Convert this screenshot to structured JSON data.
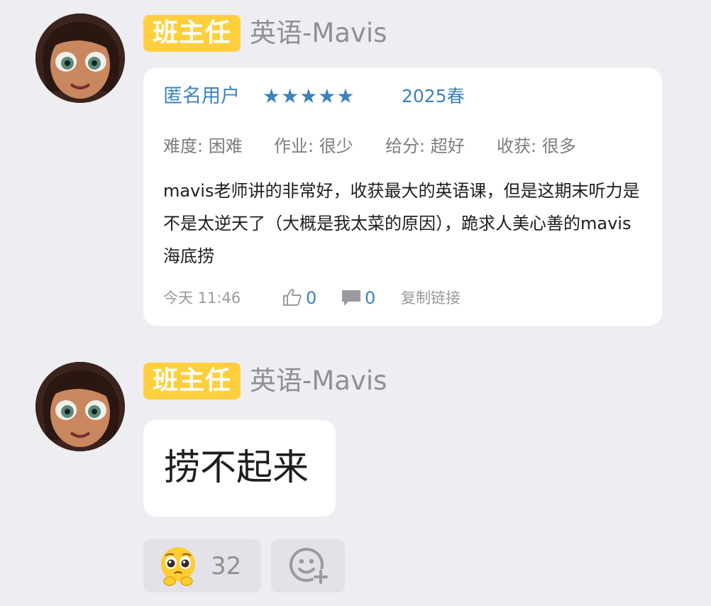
{
  "messages": [
    {
      "sender_tag": "班主任",
      "sender_name": "英语-Mavis",
      "review": {
        "user": "匿名用户",
        "stars": "★★★★★",
        "rating_value": 5,
        "semester": "2025春",
        "ratings": [
          {
            "label": "难度:",
            "value": "困难"
          },
          {
            "label": "作业:",
            "value": "很少"
          },
          {
            "label": "给分:",
            "value": "超好"
          },
          {
            "label": "收获:",
            "value": "很多"
          }
        ],
        "content": "mavis老师讲的非常好，收获最大的英语课，但是这期末听力是不是太逆天了（大概是我太菜的原因），跪求人美心善的mavis海底捞",
        "time": "今天 11:46",
        "likes": "0",
        "comments": "0",
        "copy_link": "复制链接"
      }
    },
    {
      "sender_tag": "班主任",
      "sender_name": "英语-Mavis",
      "text": "捞不起来"
    }
  ],
  "reactions": {
    "emoji": "pleading-face",
    "count": "32",
    "add_icon": "add-reaction-icon"
  },
  "colors": {
    "background": "#ededf2",
    "tag": "#ffcf3d",
    "accent": "#3d82bd"
  }
}
